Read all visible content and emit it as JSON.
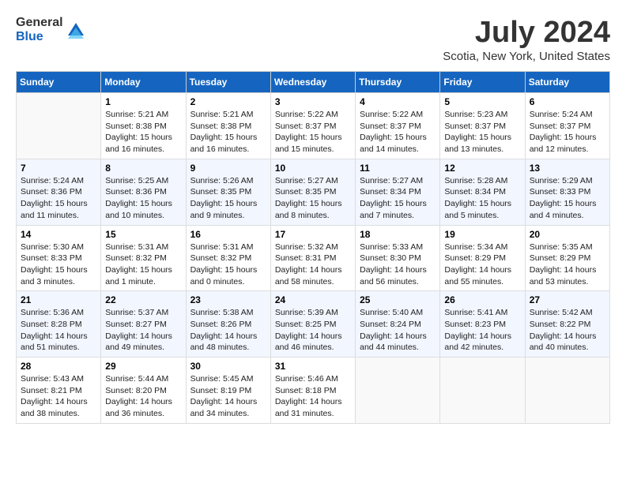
{
  "app": {
    "name_general": "General",
    "name_blue": "Blue"
  },
  "title": "July 2024",
  "subtitle": "Scotia, New York, United States",
  "days_of_week": [
    "Sunday",
    "Monday",
    "Tuesday",
    "Wednesday",
    "Thursday",
    "Friday",
    "Saturday"
  ],
  "weeks": [
    [
      {
        "day": "",
        "info": ""
      },
      {
        "day": "1",
        "info": "Sunrise: 5:21 AM\nSunset: 8:38 PM\nDaylight: 15 hours\nand 16 minutes."
      },
      {
        "day": "2",
        "info": "Sunrise: 5:21 AM\nSunset: 8:38 PM\nDaylight: 15 hours\nand 16 minutes."
      },
      {
        "day": "3",
        "info": "Sunrise: 5:22 AM\nSunset: 8:37 PM\nDaylight: 15 hours\nand 15 minutes."
      },
      {
        "day": "4",
        "info": "Sunrise: 5:22 AM\nSunset: 8:37 PM\nDaylight: 15 hours\nand 14 minutes."
      },
      {
        "day": "5",
        "info": "Sunrise: 5:23 AM\nSunset: 8:37 PM\nDaylight: 15 hours\nand 13 minutes."
      },
      {
        "day": "6",
        "info": "Sunrise: 5:24 AM\nSunset: 8:37 PM\nDaylight: 15 hours\nand 12 minutes."
      }
    ],
    [
      {
        "day": "7",
        "info": "Sunrise: 5:24 AM\nSunset: 8:36 PM\nDaylight: 15 hours\nand 11 minutes."
      },
      {
        "day": "8",
        "info": "Sunrise: 5:25 AM\nSunset: 8:36 PM\nDaylight: 15 hours\nand 10 minutes."
      },
      {
        "day": "9",
        "info": "Sunrise: 5:26 AM\nSunset: 8:35 PM\nDaylight: 15 hours\nand 9 minutes."
      },
      {
        "day": "10",
        "info": "Sunrise: 5:27 AM\nSunset: 8:35 PM\nDaylight: 15 hours\nand 8 minutes."
      },
      {
        "day": "11",
        "info": "Sunrise: 5:27 AM\nSunset: 8:34 PM\nDaylight: 15 hours\nand 7 minutes."
      },
      {
        "day": "12",
        "info": "Sunrise: 5:28 AM\nSunset: 8:34 PM\nDaylight: 15 hours\nand 5 minutes."
      },
      {
        "day": "13",
        "info": "Sunrise: 5:29 AM\nSunset: 8:33 PM\nDaylight: 15 hours\nand 4 minutes."
      }
    ],
    [
      {
        "day": "14",
        "info": "Sunrise: 5:30 AM\nSunset: 8:33 PM\nDaylight: 15 hours\nand 3 minutes."
      },
      {
        "day": "15",
        "info": "Sunrise: 5:31 AM\nSunset: 8:32 PM\nDaylight: 15 hours\nand 1 minute."
      },
      {
        "day": "16",
        "info": "Sunrise: 5:31 AM\nSunset: 8:32 PM\nDaylight: 15 hours\nand 0 minutes."
      },
      {
        "day": "17",
        "info": "Sunrise: 5:32 AM\nSunset: 8:31 PM\nDaylight: 14 hours\nand 58 minutes."
      },
      {
        "day": "18",
        "info": "Sunrise: 5:33 AM\nSunset: 8:30 PM\nDaylight: 14 hours\nand 56 minutes."
      },
      {
        "day": "19",
        "info": "Sunrise: 5:34 AM\nSunset: 8:29 PM\nDaylight: 14 hours\nand 55 minutes."
      },
      {
        "day": "20",
        "info": "Sunrise: 5:35 AM\nSunset: 8:29 PM\nDaylight: 14 hours\nand 53 minutes."
      }
    ],
    [
      {
        "day": "21",
        "info": "Sunrise: 5:36 AM\nSunset: 8:28 PM\nDaylight: 14 hours\nand 51 minutes."
      },
      {
        "day": "22",
        "info": "Sunrise: 5:37 AM\nSunset: 8:27 PM\nDaylight: 14 hours\nand 49 minutes."
      },
      {
        "day": "23",
        "info": "Sunrise: 5:38 AM\nSunset: 8:26 PM\nDaylight: 14 hours\nand 48 minutes."
      },
      {
        "day": "24",
        "info": "Sunrise: 5:39 AM\nSunset: 8:25 PM\nDaylight: 14 hours\nand 46 minutes."
      },
      {
        "day": "25",
        "info": "Sunrise: 5:40 AM\nSunset: 8:24 PM\nDaylight: 14 hours\nand 44 minutes."
      },
      {
        "day": "26",
        "info": "Sunrise: 5:41 AM\nSunset: 8:23 PM\nDaylight: 14 hours\nand 42 minutes."
      },
      {
        "day": "27",
        "info": "Sunrise: 5:42 AM\nSunset: 8:22 PM\nDaylight: 14 hours\nand 40 minutes."
      }
    ],
    [
      {
        "day": "28",
        "info": "Sunrise: 5:43 AM\nSunset: 8:21 PM\nDaylight: 14 hours\nand 38 minutes."
      },
      {
        "day": "29",
        "info": "Sunrise: 5:44 AM\nSunset: 8:20 PM\nDaylight: 14 hours\nand 36 minutes."
      },
      {
        "day": "30",
        "info": "Sunrise: 5:45 AM\nSunset: 8:19 PM\nDaylight: 14 hours\nand 34 minutes."
      },
      {
        "day": "31",
        "info": "Sunrise: 5:46 AM\nSunset: 8:18 PM\nDaylight: 14 hours\nand 31 minutes."
      },
      {
        "day": "",
        "info": ""
      },
      {
        "day": "",
        "info": ""
      },
      {
        "day": "",
        "info": ""
      }
    ]
  ]
}
